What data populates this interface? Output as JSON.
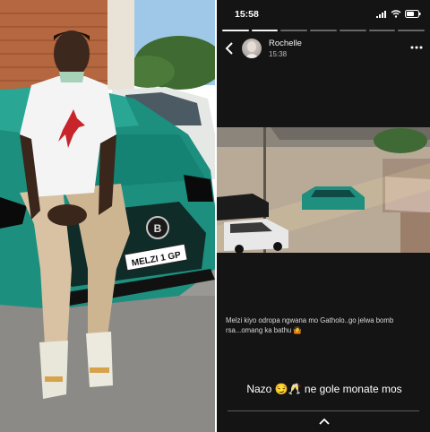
{
  "left_photo": {
    "plate_text": "MELZI 1 GP",
    "badge_text": "B"
  },
  "story": {
    "status_time": "15:58",
    "progress_segments_total": 7,
    "progress_segments_done": 2,
    "username": "Rochelle",
    "timestamp": "15:38",
    "caption": "Melzi kiyo odropa ngwana mo Gatholo..go jelwa bomb rsa...omang ka bathu 🤷",
    "reply": "Nazo 😏🥂 ne gole monate mos",
    "icons": [
      "back-arrow-icon",
      "more-icon",
      "chevron-up-icon",
      "signal-icon",
      "wifi-icon",
      "battery-icon"
    ]
  }
}
